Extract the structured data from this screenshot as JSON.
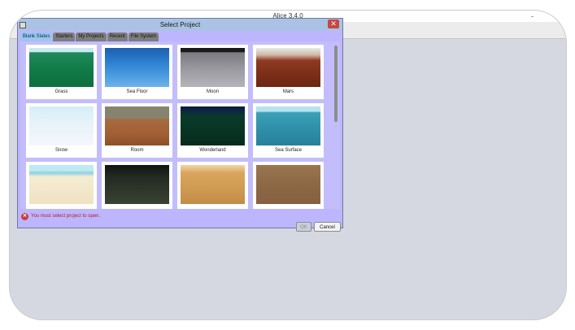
{
  "app": {
    "title": "Alice 3.4.0",
    "minimize_glyph": "-"
  },
  "dialog": {
    "title": "Select Project",
    "close_glyph": "✕",
    "tabs": [
      {
        "label": "Blank Slates",
        "active": true
      },
      {
        "label": "Starters"
      },
      {
        "label": "My Projects"
      },
      {
        "label": "Recent"
      },
      {
        "label": "File System"
      }
    ],
    "templates": [
      {
        "label": "Grass"
      },
      {
        "label": "Sea Floor"
      },
      {
        "label": "Moon"
      },
      {
        "label": "Mars"
      },
      {
        "label": "Snow"
      },
      {
        "label": "Room"
      },
      {
        "label": "Wonderland"
      },
      {
        "label": "Sea Surface"
      },
      {
        "label": ""
      },
      {
        "label": ""
      },
      {
        "label": ""
      },
      {
        "label": ""
      }
    ],
    "error": {
      "icon": "error-icon",
      "glyph": "✕",
      "message": "You must select project to open."
    },
    "buttons": {
      "ok": "OK",
      "cancel": "Cancel"
    }
  },
  "colors": {
    "dialog_bg": "#bdb6ff",
    "title_bar": "#aac3e4",
    "close": "#c9463d",
    "active_tab": "#9cc6ec",
    "error_text": "#b02222"
  }
}
